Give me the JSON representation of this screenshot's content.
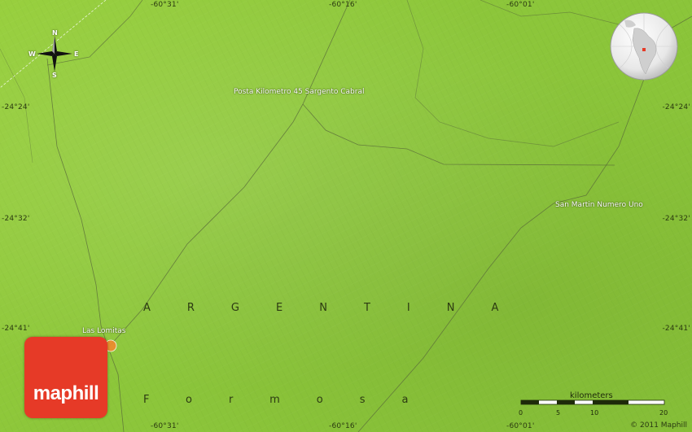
{
  "map": {
    "country_label": "ARGENTINA",
    "province_label": "Formosa",
    "places": [
      {
        "name": "Posta Kilometro 45 Sargento Cabral"
      },
      {
        "name": "San Martin Numero Uno"
      },
      {
        "name": "Las Lomitas"
      }
    ],
    "longitude_labels": [
      "-60°31'",
      "-60°16'",
      "-60°01'"
    ],
    "latitude_labels": [
      "-24°24'",
      "-24°32'",
      "-24°41'"
    ],
    "compass": {
      "north": "N",
      "south": "S",
      "east": "E",
      "west": "W"
    },
    "scale": {
      "unit_label": "kilometers",
      "ticks": [
        "0",
        "5",
        "10",
        "20"
      ]
    },
    "brand": "maphill",
    "copyright": "© 2011 Maphill",
    "colors": {
      "terrain": "#8cc63f",
      "logo": "#e63a27",
      "roads": "#5a6b3a"
    }
  }
}
